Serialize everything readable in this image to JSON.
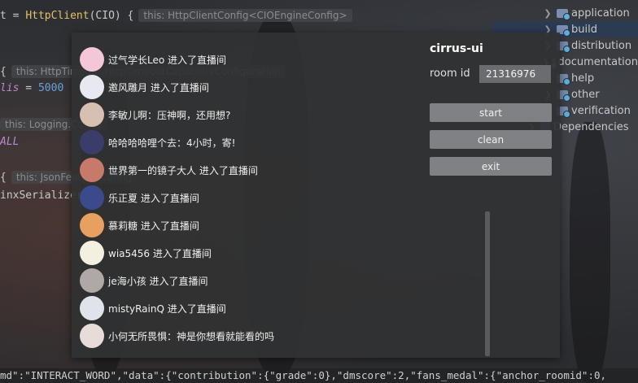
{
  "editor": {
    "line1": {
      "prefix": "t = ",
      "call": "HttpClient",
      "args": "(CIO) {",
      "hint": "this: HttpClientConfig<CIOEngineConfig>"
    },
    "line2": {
      "prefix": "{",
      "hint": "this: HttpTimeout.HttpTimeoutCapabilityConfiguration"
    },
    "line3": {
      "name": "lis",
      "eq": " = ",
      "value": "5000"
    },
    "line4": {
      "hint": "this: Logging.Config"
    },
    "line5": {
      "text": "ALL"
    },
    "line6": {
      "prefix": "{",
      "hint": "this: JsonFeature.Config"
    },
    "line7": {
      "text": "inxSerializer("
    },
    "bottom_log": "md\":\"INTERACT_WORD\",\"data\":{\"contribution\":{\"grade\":0},\"dmscore\":2,\"fans_medal\":{\"anchor_roomid\":0,"
  },
  "project_tree": {
    "items": [
      {
        "label": "application",
        "selected": false
      },
      {
        "label": "build",
        "selected": true
      },
      {
        "label": "distribution",
        "selected": false
      },
      {
        "label": "documentation",
        "selected": false
      },
      {
        "label": "help",
        "selected": false
      },
      {
        "label": "other",
        "selected": false
      },
      {
        "label": "verification",
        "selected": false
      }
    ],
    "dependencies_label": "Dependencies"
  },
  "app": {
    "title": "cirrus-ui",
    "room_label": "room id",
    "room_value": "21316976",
    "buttons": {
      "start": "start",
      "clean": "clean",
      "exit": "exit"
    },
    "messages": [
      {
        "text": "过气学长Leo 进入了直播间",
        "avatar_color": "#f3c6d8"
      },
      {
        "text": "邀风雕月 进入了直播间",
        "avatar_color": "#e8e8f0"
      },
      {
        "text": "李敏儿啊：压神啊，还用想?",
        "avatar_color": "#d8c0b0"
      },
      {
        "text": "哈哈哈哈哩个去：4小时，寄!",
        "avatar_color": "#3a3d6a"
      },
      {
        "text": "世界第一的镜子大人 进入了直播间",
        "avatar_color": "#c87a6a"
      },
      {
        "text": "乐正夏 进入了直播间",
        "avatar_color": "#3a4a8a"
      },
      {
        "text": "慕莉糖 进入了直播间",
        "avatar_color": "#e8a060"
      },
      {
        "text": "wia5456 进入了直播间",
        "avatar_color": "#f4f0e0"
      },
      {
        "text": "je海小孩 进入了直播间",
        "avatar_color": "#b0a8a6"
      },
      {
        "text": "mistyRainQ 进入了直播间",
        "avatar_color": "#e0e4ea"
      },
      {
        "text": "小何无所畏惧：神是你想看就能看的吗",
        "avatar_color": "#e8dcd8"
      }
    ]
  }
}
